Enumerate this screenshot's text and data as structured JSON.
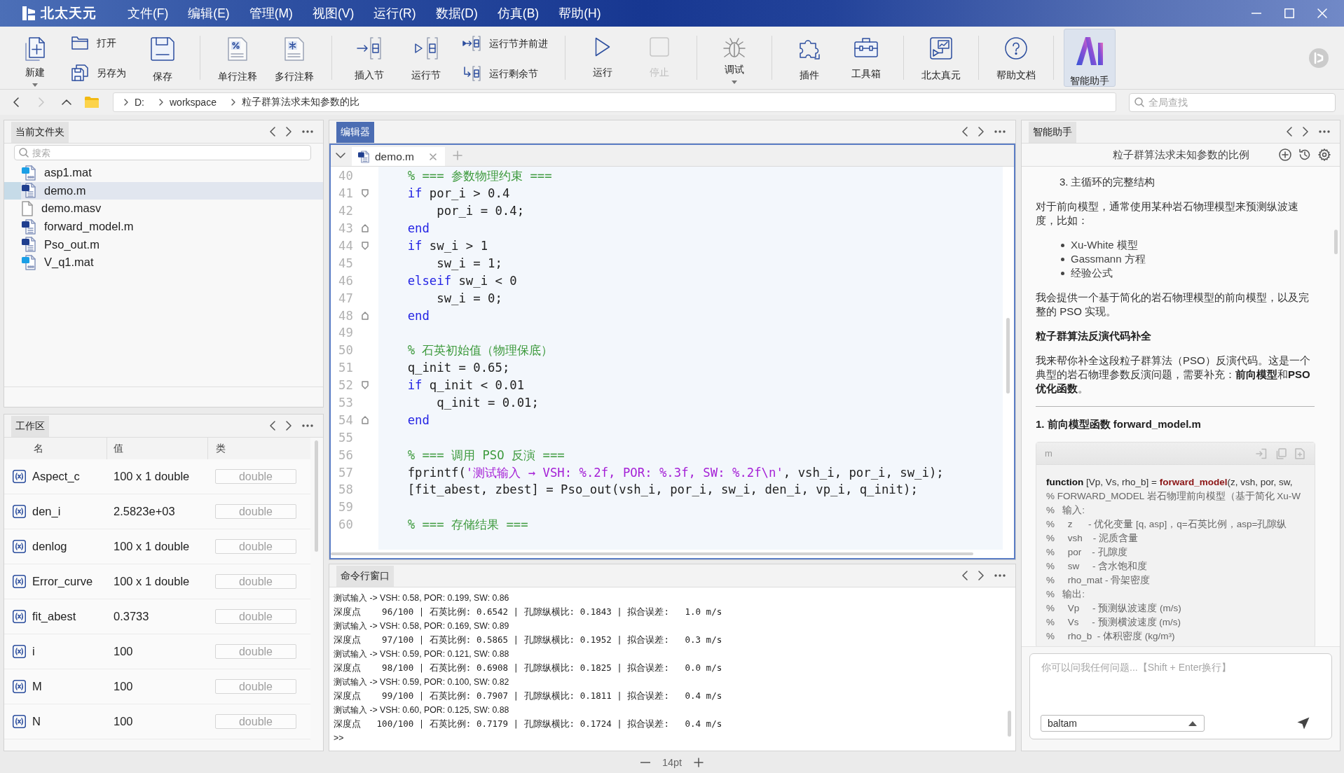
{
  "title_bar": {
    "app_name": "北太天元",
    "menus": [
      "文件(F)",
      "编辑(E)",
      "管理(M)",
      "视图(V)",
      "运行(R)",
      "数据(D)",
      "仿真(B)",
      "帮助(H)"
    ]
  },
  "toolbar": [
    {
      "buttons": [
        {
          "label": "新建",
          "kind": "large",
          "has_menu": true,
          "disabled": false,
          "selected": false
        },
        {
          "label": "打开",
          "kind": "small",
          "has_menu": false,
          "disabled": false,
          "selected": false
        },
        {
          "label": "另存为",
          "kind": "small",
          "has_menu": false,
          "disabled": false,
          "selected": false
        },
        {
          "label": "保存",
          "kind": "large",
          "has_menu": false,
          "disabled": false,
          "selected": false
        }
      ]
    },
    {
      "buttons": [
        {
          "label": "单行注释",
          "kind": "large",
          "has_menu": false,
          "disabled": false,
          "selected": false
        },
        {
          "label": "多行注释",
          "kind": "large",
          "has_menu": false,
          "disabled": false,
          "selected": false
        }
      ]
    },
    {
      "buttons": [
        {
          "label": "插入节",
          "kind": "large",
          "has_menu": false,
          "disabled": false,
          "selected": false
        },
        {
          "label": "运行节",
          "kind": "large",
          "has_menu": false,
          "disabled": false,
          "selected": false
        },
        {
          "label": "运行节并前进",
          "kind": "small",
          "has_menu": false,
          "disabled": false,
          "selected": false
        },
        {
          "label": "运行剩余节",
          "kind": "small",
          "has_menu": false,
          "disabled": false,
          "selected": false
        }
      ]
    },
    {
      "buttons": [
        {
          "label": "运行",
          "kind": "large",
          "has_menu": false,
          "disabled": false,
          "selected": false
        },
        {
          "label": "停止",
          "kind": "large",
          "has_menu": false,
          "disabled": true,
          "selected": false
        }
      ]
    },
    {
      "buttons": [
        {
          "label": "调试",
          "kind": "large",
          "has_menu": true,
          "disabled": false,
          "selected": false
        }
      ]
    },
    {
      "buttons": [
        {
          "label": "插件",
          "kind": "large",
          "has_menu": false,
          "disabled": false,
          "selected": false
        },
        {
          "label": "工具箱",
          "kind": "large",
          "has_menu": false,
          "disabled": false,
          "selected": false
        }
      ]
    },
    {
      "buttons": [
        {
          "label": "北太真元",
          "kind": "large",
          "has_menu": false,
          "disabled": false,
          "selected": false
        }
      ]
    },
    {
      "buttons": [
        {
          "label": "帮助文档",
          "kind": "large",
          "has_menu": false,
          "disabled": false,
          "selected": false
        }
      ]
    },
    {
      "buttons": [
        {
          "label": "智能助手",
          "kind": "large",
          "has_menu": false,
          "disabled": false,
          "selected": true
        }
      ]
    }
  ],
  "address_bar": {
    "buttons": [
      {
        "kind": "back",
        "disabled": false
      },
      {
        "kind": "forward",
        "disabled": true
      },
      {
        "kind": "up",
        "disabled": false
      }
    ],
    "path": [
      "D:",
      "workspace",
      "粒子群算法求未知参数的比"
    ],
    "search": {
      "placeholder": "全局查找"
    }
  },
  "folder_panel": {
    "title": "当前文件夹",
    "focused": false,
    "search": {
      "placeholder": "搜索"
    },
    "files": [
      {
        "name": "asp1.mat",
        "kind": "mat",
        "selected": false
      },
      {
        "name": "demo.m",
        "kind": "m",
        "selected": true
      },
      {
        "name": "demo.masv",
        "kind": "file",
        "selected": false
      },
      {
        "name": "forward_model.m",
        "kind": "m",
        "selected": false
      },
      {
        "name": "Pso_out.m",
        "kind": "m",
        "selected": false
      },
      {
        "name": "V_q1.mat",
        "kind": "mat",
        "selected": false
      }
    ]
  },
  "workspace_panel": {
    "title": "工作区",
    "focused": false,
    "columns": [
      "名",
      "值",
      "类"
    ],
    "rows": [
      {
        "name": "Aspect_c",
        "value": "100 x 1 double",
        "class": "double"
      },
      {
        "name": "den_i",
        "value": "2.5823e+03",
        "class": "double"
      },
      {
        "name": "denlog",
        "value": "100 x 1 double",
        "class": "double"
      },
      {
        "name": "Error_curve",
        "value": "100 x 1 double",
        "class": "double"
      },
      {
        "name": "fit_abest",
        "value": "0.3733",
        "class": "double"
      },
      {
        "name": "i",
        "value": "100",
        "class": "double"
      },
      {
        "name": "M",
        "value": "100",
        "class": "double"
      },
      {
        "name": "N",
        "value": "100",
        "class": "double"
      }
    ]
  },
  "editor": {
    "title": "编辑器",
    "focused": true,
    "tabs": [
      {
        "label": "demo.m",
        "selected": true
      }
    ],
    "lines": [
      {
        "number": "40",
        "kind": "line",
        "tokens": [
          {
            "kind": "comment",
            "text": "    % === 参数物理约束 ==="
          }
        ]
      },
      {
        "number": "41",
        "kind": "fold_start",
        "tokens": [
          {
            "kind": "keyword",
            "text": "    if"
          },
          {
            "kind": "plain",
            "text": " por_i > 0.4"
          }
        ]
      },
      {
        "number": "42",
        "kind": "line",
        "tokens": [
          {
            "kind": "plain",
            "text": "        por_i = 0.4;"
          }
        ]
      },
      {
        "number": "43",
        "kind": "fold_end",
        "tokens": [
          {
            "kind": "keyword",
            "text": "    end"
          }
        ]
      },
      {
        "number": "44",
        "kind": "fold_start",
        "tokens": [
          {
            "kind": "keyword",
            "text": "    if"
          },
          {
            "kind": "plain",
            "text": " sw_i > 1"
          }
        ]
      },
      {
        "number": "45",
        "kind": "line",
        "tokens": [
          {
            "kind": "plain",
            "text": "        sw_i = 1;"
          }
        ]
      },
      {
        "number": "46",
        "kind": "line",
        "tokens": [
          {
            "kind": "keyword",
            "text": "    elseif"
          },
          {
            "kind": "plain",
            "text": " sw_i < 0"
          }
        ]
      },
      {
        "number": "47",
        "kind": "line",
        "tokens": [
          {
            "kind": "plain",
            "text": "        sw_i = 0;"
          }
        ]
      },
      {
        "number": "48",
        "kind": "fold_end",
        "tokens": [
          {
            "kind": "keyword",
            "text": "    end"
          }
        ]
      },
      {
        "number": "49",
        "kind": "line"
      },
      {
        "number": "50",
        "kind": "line",
        "tokens": [
          {
            "kind": "comment",
            "text": "    % 石英初始值（物理保底）"
          }
        ]
      },
      {
        "number": "51",
        "kind": "line",
        "tokens": [
          {
            "kind": "plain",
            "text": "    q_init = 0.65;"
          }
        ]
      },
      {
        "number": "52",
        "kind": "fold_start",
        "tokens": [
          {
            "kind": "keyword",
            "text": "    if"
          },
          {
            "kind": "plain",
            "text": " q_init < 0.01"
          }
        ]
      },
      {
        "number": "53",
        "kind": "line",
        "tokens": [
          {
            "kind": "plain",
            "text": "        q_init = 0.01;"
          }
        ]
      },
      {
        "number": "54",
        "kind": "fold_end",
        "tokens": [
          {
            "kind": "keyword",
            "text": "    end"
          }
        ]
      },
      {
        "number": "55",
        "kind": "line"
      },
      {
        "number": "56",
        "kind": "line",
        "tokens": [
          {
            "kind": "comment",
            "text": "    % === 调用 PSO 反演 ==="
          }
        ]
      },
      {
        "number": "57",
        "kind": "line",
        "tokens": [
          {
            "kind": "plain",
            "text": "    fprintf("
          },
          {
            "kind": "string",
            "text": "'测试输入 → VSH: %.2f, POR: %.3f, SW: %.2f\\n'"
          },
          {
            "kind": "plain",
            "text": ", vsh_i, por_i, sw_i);"
          }
        ]
      },
      {
        "number": "58",
        "kind": "line",
        "tokens": [
          {
            "kind": "plain",
            "text": "    [fit_abest, zbest] = Pso_out(vsh_i, por_i, sw_i, den_i, vp_i, q_init);"
          }
        ]
      },
      {
        "number": "59",
        "kind": "line"
      },
      {
        "number": "60",
        "kind": "line",
        "tokens": [
          {
            "kind": "comment",
            "text": "    % === 存储结果 ==="
          }
        ]
      }
    ]
  },
  "command_window": {
    "title": "命令行窗口",
    "focused": false,
    "lines": [
      {
        "kind": "echo",
        "text": "测试输入 -> VSH: 0.58, POR: 0.199, SW: 0.86"
      },
      {
        "kind": "result",
        "text": "深度点    96/100 | 石英比例: 0.6542 | 孔隙纵横比: 0.1843 | 拟合误差:   1.0 m/s"
      },
      {
        "kind": "echo",
        "text": "测试输入 -> VSH: 0.58, POR: 0.169, SW: 0.89"
      },
      {
        "kind": "result",
        "text": "深度点    97/100 | 石英比例: 0.5865 | 孔隙纵横比: 0.1952 | 拟合误差:   0.3 m/s"
      },
      {
        "kind": "echo",
        "text": "测试输入 -> VSH: 0.59, POR: 0.121, SW: 0.88"
      },
      {
        "kind": "result",
        "text": "深度点    98/100 | 石英比例: 0.6908 | 孔隙纵横比: 0.1825 | 拟合误差:   0.0 m/s"
      },
      {
        "kind": "echo",
        "text": "测试输入 -> VSH: 0.59, POR: 0.100, SW: 0.82"
      },
      {
        "kind": "result",
        "text": "深度点    99/100 | 石英比例: 0.7907 | 孔隙纵横比: 0.1811 | 拟合误差:   0.4 m/s"
      },
      {
        "kind": "echo",
        "text": "测试输入 -> VSH: 0.60, POR: 0.125, SW: 0.88"
      },
      {
        "kind": "result",
        "text": "深度点   100/100 | 石英比例: 0.7179 | 孔隙纵横比: 0.1724 | 拟合误差:   0.4 m/s"
      }
    ],
    "prompt": ">>"
  },
  "assistant_panel": {
    "title": "智能助手",
    "focused": false,
    "conversation_title": "粒子群算法求未知参数的比例",
    "content": [
      {
        "kind": "numbered",
        "marker": "3.",
        "text": "主循环的完整结构"
      },
      {
        "kind": "paragraph",
        "text": "对于前向模型，通常使用某种岩石物理模型来预测纵波速度，比如："
      },
      {
        "kind": "bullets",
        "items": [
          "Xu-White 模型",
          "Gassmann 方程",
          "经验公式"
        ]
      },
      {
        "kind": "paragraph",
        "text": "我会提供一个基于简化的岩石物理模型的前向模型，以及完整的 PSO 实现。"
      },
      {
        "kind": "heading",
        "text": "粒子群算法反演代码补全"
      },
      {
        "kind": "paragraph",
        "text": "我来帮你补全这段粒子群算法（PSO）反演代码。这是一个典型的岩石物理参数反演问题，需要补充：**前向模型**和**PSO优化函数**。"
      },
      {
        "kind": "rule"
      },
      {
        "kind": "heading",
        "text": "1. 前向模型函数 forward_model.m"
      },
      {
        "kind": "code",
        "language": "m",
        "lines": [
          {
            "tokens": [
              {
                "kind": "keyword",
                "text": "function"
              },
              {
                "kind": "plain",
                "text": " [Vp, Vs, rho_b] = "
              },
              {
                "kind": "function",
                "text": "forward_model"
              },
              {
                "kind": "plain",
                "text": "(z, vsh, por, sw,"
              }
            ]
          },
          {
            "tokens": [
              {
                "kind": "comment",
                "text": "% FORWARD_MODEL 岩石物理前向模型（基于简化 Xu-W"
              }
            ]
          },
          {
            "tokens": [
              {
                "kind": "comment",
                "text": "%   输入:"
              }
            ]
          },
          {
            "tokens": [
              {
                "kind": "comment",
                "text": "%     z      - 优化变量 [q, asp]，q=石英比例，asp=孔隙纵"
              }
            ]
          },
          {
            "tokens": [
              {
                "kind": "comment",
                "text": "%     vsh    - 泥质含量"
              }
            ]
          },
          {
            "tokens": [
              {
                "kind": "comment",
                "text": "%     por    - 孔隙度"
              }
            ]
          },
          {
            "tokens": [
              {
                "kind": "comment",
                "text": "%     sw     - 含水饱和度"
              }
            ]
          },
          {
            "tokens": [
              {
                "kind": "comment",
                "text": "%     rho_mat - 骨架密度"
              }
            ]
          },
          {
            "tokens": [
              {
                "kind": "comment",
                "text": "%   输出:"
              }
            ]
          },
          {
            "tokens": [
              {
                "kind": "comment",
                "text": "%     Vp     - 预测纵波速度 (m/s)"
              }
            ]
          },
          {
            "tokens": [
              {
                "kind": "comment",
                "text": "%     Vs     - 预测横波速度 (m/s)"
              }
            ]
          },
          {
            "tokens": [
              {
                "kind": "comment",
                "text": "%     rho_b  - 体积密度 (kg/m³)"
              }
            ]
          }
        ]
      }
    ],
    "input": {
      "placeholder": "你可以问我任何问题...【Shift + Enter换行】"
    },
    "model_select": {
      "value": "baltam"
    }
  },
  "status_bar": {
    "font_size": "14pt"
  }
}
